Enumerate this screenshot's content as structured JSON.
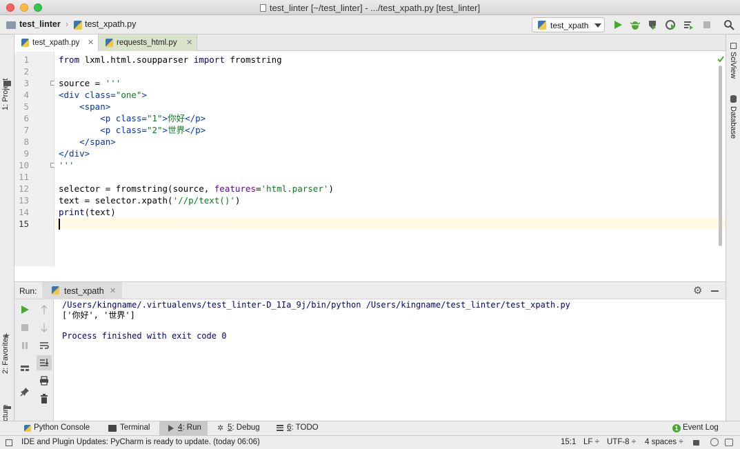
{
  "window": {
    "title": "test_linter [~/test_linter] - .../test_xpath.py [test_linter]"
  },
  "breadcrumb": {
    "project": "test_linter",
    "file": "test_xpath.py"
  },
  "toolbar": {
    "run_config": "test_xpath"
  },
  "sidebars": {
    "left_project": "1: Project",
    "left_favorites": "2: Favorites",
    "left_structure": "Z: Structure",
    "right_sciview": "SciView",
    "right_database": "Database"
  },
  "editor_tabs": [
    {
      "label": "test_xpath.py"
    },
    {
      "label": "requests_html.py"
    }
  ],
  "code_lines": [
    {
      "num": "1",
      "segments": [
        {
          "t": "from",
          "c": "kw"
        },
        {
          "t": " lxml.html.soupparser ",
          "c": ""
        },
        {
          "t": "import",
          "c": "kw"
        },
        {
          "t": " fromstring",
          "c": ""
        }
      ]
    },
    {
      "num": "2",
      "segments": []
    },
    {
      "num": "3",
      "segments": [
        {
          "t": "source = ",
          "c": ""
        },
        {
          "t": "'''",
          "c": "str"
        }
      ]
    },
    {
      "num": "4",
      "segments": [
        {
          "t": "<div ",
          "c": "tag"
        },
        {
          "t": "class=",
          "c": "attr"
        },
        {
          "t": "\"one\"",
          "c": "str"
        },
        {
          "t": ">",
          "c": "tag"
        }
      ]
    },
    {
      "num": "5",
      "segments": [
        {
          "t": "    ",
          "c": ""
        },
        {
          "t": "<span>",
          "c": "tag"
        }
      ]
    },
    {
      "num": "6",
      "segments": [
        {
          "t": "        ",
          "c": ""
        },
        {
          "t": "<p ",
          "c": "tag"
        },
        {
          "t": "class=",
          "c": "attr"
        },
        {
          "t": "\"1\"",
          "c": "str"
        },
        {
          "t": ">",
          "c": "tag"
        },
        {
          "t": "你好",
          "c": "str"
        },
        {
          "t": "</p>",
          "c": "tag"
        }
      ]
    },
    {
      "num": "7",
      "segments": [
        {
          "t": "        ",
          "c": ""
        },
        {
          "t": "<p ",
          "c": "tag"
        },
        {
          "t": "class=",
          "c": "attr"
        },
        {
          "t": "\"2\"",
          "c": "str"
        },
        {
          "t": ">",
          "c": "tag"
        },
        {
          "t": "世界",
          "c": "str"
        },
        {
          "t": "</p>",
          "c": "tag"
        }
      ]
    },
    {
      "num": "8",
      "segments": [
        {
          "t": "    ",
          "c": ""
        },
        {
          "t": "</span>",
          "c": "tag"
        }
      ]
    },
    {
      "num": "9",
      "segments": [
        {
          "t": "</div>",
          "c": "tag"
        }
      ]
    },
    {
      "num": "10",
      "segments": [
        {
          "t": "'''",
          "c": "str"
        }
      ]
    },
    {
      "num": "11",
      "segments": []
    },
    {
      "num": "12",
      "segments": [
        {
          "t": "selector = fromstring(source, ",
          "c": ""
        },
        {
          "t": "features",
          "c": "kwarg"
        },
        {
          "t": "=",
          "c": ""
        },
        {
          "t": "'html.parser'",
          "c": "str"
        },
        {
          "t": ")",
          "c": ""
        }
      ]
    },
    {
      "num": "13",
      "segments": [
        {
          "t": "text = selector.xpath(",
          "c": ""
        },
        {
          "t": "'//p/text()'",
          "c": "str"
        },
        {
          "t": ")",
          "c": ""
        }
      ]
    },
    {
      "num": "14",
      "segments": [
        {
          "t": "print",
          "c": "fn"
        },
        {
          "t": "(text)",
          "c": ""
        }
      ]
    },
    {
      "num": "15",
      "segments": []
    }
  ],
  "run_panel": {
    "label": "Run:",
    "tab": "test_xpath",
    "output": [
      {
        "text": "/Users/kingname/.virtualenvs/test_linter-D_1Ia_9j/bin/python /Users/kingname/test_linter/test_xpath.py",
        "color": "#000080"
      },
      {
        "text": "['你好', '世界']",
        "color": "#000000"
      },
      {
        "text": "",
        "color": "#000000"
      },
      {
        "text": "Process finished with exit code 0",
        "color": "#000080"
      }
    ]
  },
  "bottom_tabs": {
    "python_console": "Python Console",
    "terminal": "Terminal",
    "run_num": "4",
    "run_label": ": Run",
    "debug_num": "5",
    "debug_label": ": Debug",
    "todo_num": "6",
    "todo_label": ": TODO",
    "event_log": "Event Log"
  },
  "status": {
    "message": "IDE and Plugin Updates: PyCharm is ready to update. (today 06:06)",
    "position": "15:1",
    "line_sep": "LF ÷",
    "encoding": "UTF-8 ÷",
    "indent": "4 spaces ÷"
  },
  "colors": {
    "accent_green": "#49a834",
    "caret_line": "#fffae3",
    "keyword": "#000080",
    "string": "#067d17"
  }
}
